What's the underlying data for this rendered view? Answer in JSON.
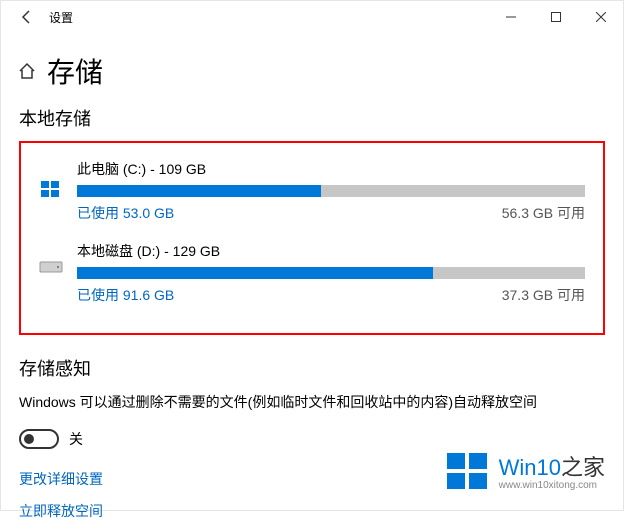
{
  "titlebar": {
    "title": "设置"
  },
  "page": {
    "title": "存储"
  },
  "local_storage": {
    "heading": "本地存储",
    "drives": [
      {
        "name": "此电脑 (C:) - 109 GB",
        "used_label": "已使用 53.0 GB",
        "free_label": "56.3 GB 可用",
        "fill_pct": 48
      },
      {
        "name": "本地磁盘 (D:) - 129 GB",
        "used_label": "已使用 91.6 GB",
        "free_label": "37.3 GB 可用",
        "fill_pct": 70
      }
    ]
  },
  "storage_sense": {
    "heading": "存储感知",
    "description": "Windows 可以通过删除不需要的文件(例如临时文件和回收站中的内容)自动释放空间",
    "toggle_state": "关"
  },
  "links": {
    "change_settings": "更改详细设置",
    "free_space": "立即释放空间"
  },
  "watermark": {
    "brand_main": "Win10",
    "brand_suffix": "之家",
    "url": "www.win10xitong.com"
  }
}
